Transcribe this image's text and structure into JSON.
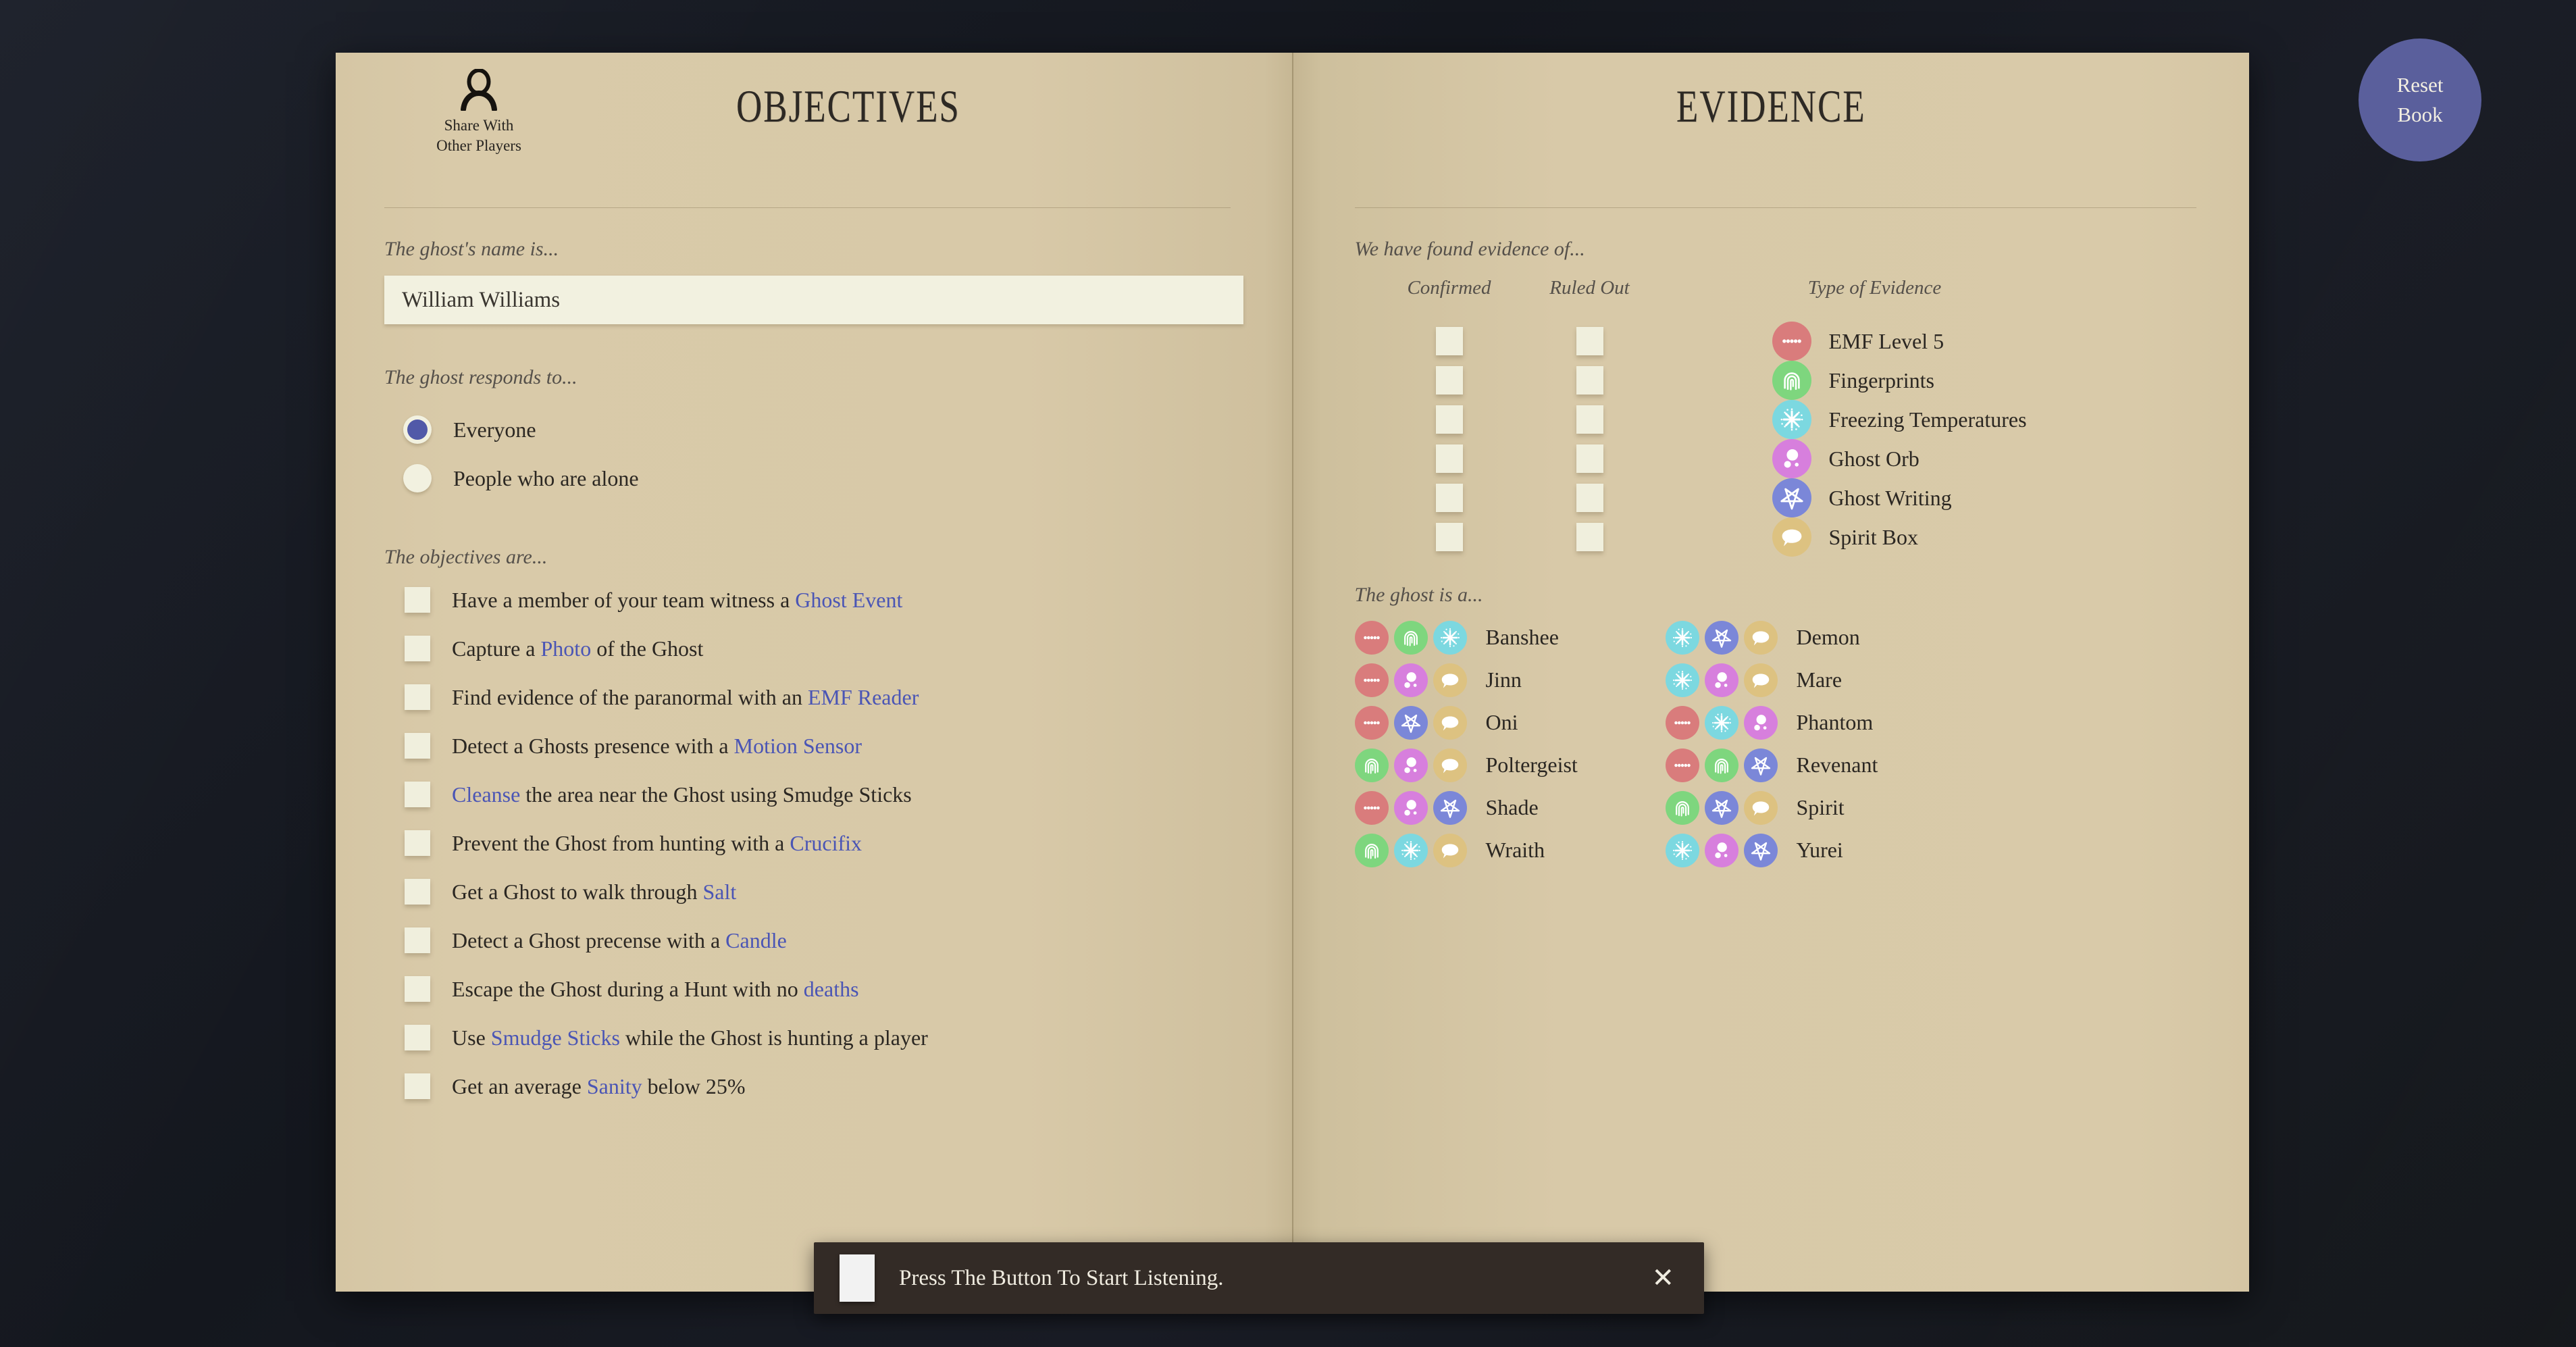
{
  "colors": {
    "page": "#d8c9a8",
    "ink": "#2b2722",
    "prompt_ink": "#55504a",
    "highlight": "#4a55b5",
    "checkbox": "#f0efdd",
    "accent_button": "#5a5f9c",
    "toast_bg": "#332b26",
    "evidence_emf": "#d97c7c",
    "evidence_fingerprints": "#7ed67e",
    "evidence_freezing": "#7cd8e0",
    "evidence_orb": "#d77fdd",
    "evidence_writing": "#7b87d8",
    "evidence_spiritbox": "#ddc281"
  },
  "reset_button": {
    "line1": "Reset",
    "line2": "Book"
  },
  "share": {
    "icon": "person-icon",
    "line1": "Share With",
    "line2": "Other Players"
  },
  "left_page": {
    "title": "OBJECTIVES",
    "name_prompt": "The ghost's name is...",
    "ghost_name_value": "William Williams",
    "ghost_name_placeholder": "",
    "responds_prompt": "The ghost responds to...",
    "responds_options": [
      {
        "label": "Everyone",
        "selected": true
      },
      {
        "label": "People who are alone",
        "selected": false
      }
    ],
    "objectives_prompt": "The objectives are...",
    "objectives": [
      {
        "checked": false,
        "parts": [
          {
            "t": "Have a member of your team witness a ",
            "hl": false
          },
          {
            "t": "Ghost Event",
            "hl": true
          }
        ]
      },
      {
        "checked": false,
        "parts": [
          {
            "t": "Capture a ",
            "hl": false
          },
          {
            "t": "Photo",
            "hl": true
          },
          {
            "t": " of the Ghost",
            "hl": false
          }
        ]
      },
      {
        "checked": false,
        "parts": [
          {
            "t": "Find evidence of the paranormal with an ",
            "hl": false
          },
          {
            "t": "EMF Reader",
            "hl": true
          }
        ]
      },
      {
        "checked": false,
        "parts": [
          {
            "t": "Detect a Ghosts presence with a ",
            "hl": false
          },
          {
            "t": "Motion Sensor",
            "hl": true
          }
        ]
      },
      {
        "checked": false,
        "parts": [
          {
            "t": "Cleanse",
            "hl": true
          },
          {
            "t": " the area near the Ghost using Smudge Sticks",
            "hl": false
          }
        ]
      },
      {
        "checked": false,
        "parts": [
          {
            "t": "Prevent the Ghost from hunting with a ",
            "hl": false
          },
          {
            "t": "Crucifix",
            "hl": true
          }
        ]
      },
      {
        "checked": false,
        "parts": [
          {
            "t": "Get a Ghost to walk through ",
            "hl": false
          },
          {
            "t": "Salt",
            "hl": true
          }
        ]
      },
      {
        "checked": false,
        "parts": [
          {
            "t": "Detect a Ghost precense with a ",
            "hl": false
          },
          {
            "t": "Candle",
            "hl": true
          }
        ]
      },
      {
        "checked": false,
        "parts": [
          {
            "t": "Escape the Ghost during a Hunt with no ",
            "hl": false
          },
          {
            "t": "deaths",
            "hl": true
          }
        ]
      },
      {
        "checked": false,
        "parts": [
          {
            "t": "Use ",
            "hl": false
          },
          {
            "t": "Smudge Sticks",
            "hl": true
          },
          {
            "t": " while the Ghost is hunting a player",
            "hl": false
          }
        ]
      },
      {
        "checked": false,
        "parts": [
          {
            "t": "Get an average ",
            "hl": false
          },
          {
            "t": "Sanity",
            "hl": true
          },
          {
            "t": " below 25%",
            "hl": false
          }
        ]
      }
    ]
  },
  "right_page": {
    "title": "EVIDENCE",
    "evidence_prompt": "We have found evidence of...",
    "column_headers": {
      "confirmed": "Confirmed",
      "ruled_out": "Ruled Out",
      "type": "Type of Evidence"
    },
    "evidence": [
      {
        "id": "emf",
        "name": "EMF Level 5",
        "icon": "emf-icon",
        "color": "#d97c7c",
        "confirmed": false,
        "ruled_out": false
      },
      {
        "id": "fingerprints",
        "name": "Fingerprints",
        "icon": "fingerprint-icon",
        "color": "#7ed67e",
        "confirmed": false,
        "ruled_out": false
      },
      {
        "id": "freezing",
        "name": "Freezing Temperatures",
        "icon": "snowflake-icon",
        "color": "#7cd8e0",
        "confirmed": false,
        "ruled_out": false
      },
      {
        "id": "orb",
        "name": "Ghost Orb",
        "icon": "ghost-orb-icon",
        "color": "#d77fdd",
        "confirmed": false,
        "ruled_out": false
      },
      {
        "id": "writing",
        "name": "Ghost Writing",
        "icon": "pentagram-icon",
        "color": "#7b87d8",
        "confirmed": false,
        "ruled_out": false
      },
      {
        "id": "spiritbox",
        "name": "Spirit Box",
        "icon": "speech-bubble-icon",
        "color": "#ddc281",
        "confirmed": false,
        "ruled_out": false
      }
    ],
    "ghost_prompt": "The ghost is a...",
    "ghosts": [
      {
        "name": "Banshee",
        "evidence": [
          "emf",
          "fingerprints",
          "freezing"
        ]
      },
      {
        "name": "Demon",
        "evidence": [
          "freezing",
          "writing",
          "spiritbox"
        ]
      },
      {
        "name": "Jinn",
        "evidence": [
          "emf",
          "orb",
          "spiritbox"
        ]
      },
      {
        "name": "Mare",
        "evidence": [
          "freezing",
          "orb",
          "spiritbox"
        ]
      },
      {
        "name": "Oni",
        "evidence": [
          "emf",
          "writing",
          "spiritbox"
        ]
      },
      {
        "name": "Phantom",
        "evidence": [
          "emf",
          "freezing",
          "orb"
        ]
      },
      {
        "name": "Poltergeist",
        "evidence": [
          "fingerprints",
          "orb",
          "spiritbox"
        ]
      },
      {
        "name": "Revenant",
        "evidence": [
          "emf",
          "fingerprints",
          "writing"
        ]
      },
      {
        "name": "Shade",
        "evidence": [
          "emf",
          "orb",
          "writing"
        ]
      },
      {
        "name": "Spirit",
        "evidence": [
          "fingerprints",
          "writing",
          "spiritbox"
        ]
      },
      {
        "name": "Wraith",
        "evidence": [
          "fingerprints",
          "freezing",
          "spiritbox"
        ]
      },
      {
        "name": "Yurei",
        "evidence": [
          "freezing",
          "orb",
          "writing"
        ]
      }
    ]
  },
  "toast": {
    "message": "Press The Button To Start Listening.",
    "close_label": "✕",
    "button_label": ""
  }
}
